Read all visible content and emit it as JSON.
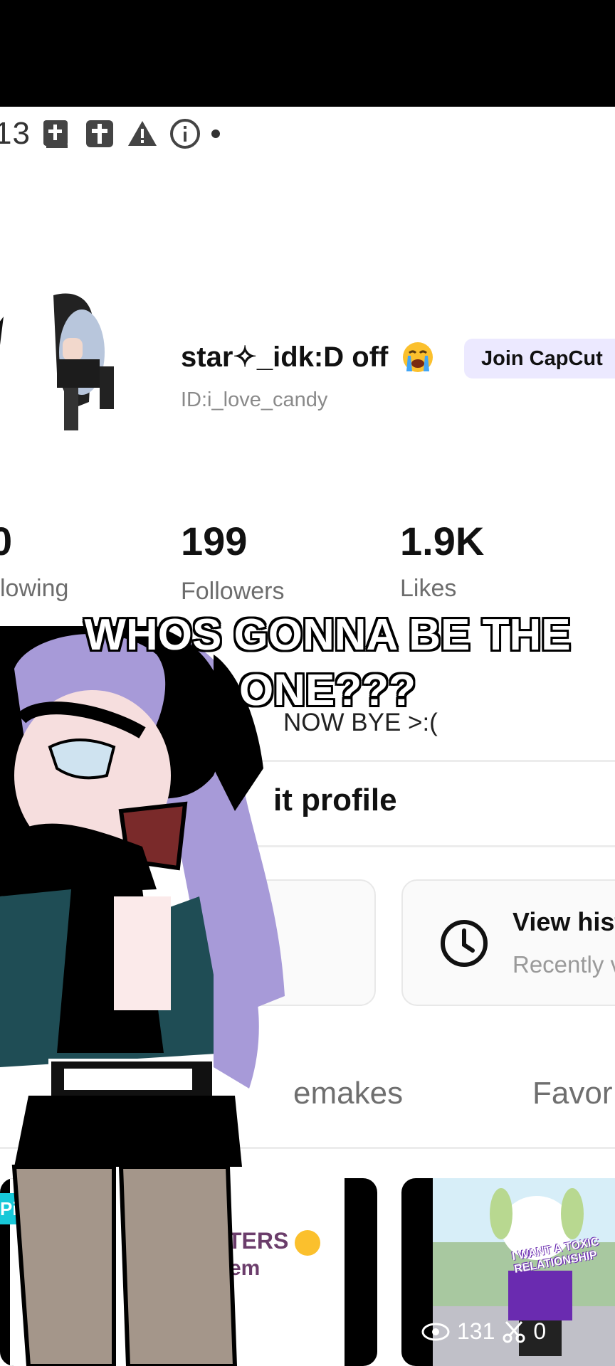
{
  "status_bar": {
    "time": "13",
    "icons": [
      "bible-plus-icon",
      "bible-cross-icon",
      "warning-icon",
      "info-icon",
      "dot-icon"
    ]
  },
  "profile": {
    "username": "star✧_idk:D  off",
    "username_emoji": "crying-face-emoji",
    "join_button": "Join CapCut",
    "user_id": "ID:i_love_candy",
    "stats": [
      {
        "value": "0",
        "label": "lowing"
      },
      {
        "value": "199",
        "label": "Followers"
      },
      {
        "value": "1.9K",
        "label": "Likes"
      }
    ],
    "bio": "NOW BYE >:(",
    "edit_profile": "it profile"
  },
  "view_history_card": {
    "title": "View hist",
    "subtitle": "Recently v",
    "icon": "clock-icon"
  },
  "tabs": [
    "emakes",
    "Favor"
  ],
  "grid": {
    "thumb1_tag": "Pi",
    "thumb1_text_line1": "TERS",
    "thumb1_text_line2": "em",
    "thumb2_views": "131",
    "thumb2_remixes": "0",
    "thumb2_caption": "I WANT A TOXIC RELATIONSHIP"
  },
  "overlay_caption": "WHOS GONNA BE THE ONE???",
  "colors": {
    "join_pill_bg": "#ece9ff",
    "tag_cyan": "#17c8d8",
    "hair_purple": "#a79ad8"
  }
}
